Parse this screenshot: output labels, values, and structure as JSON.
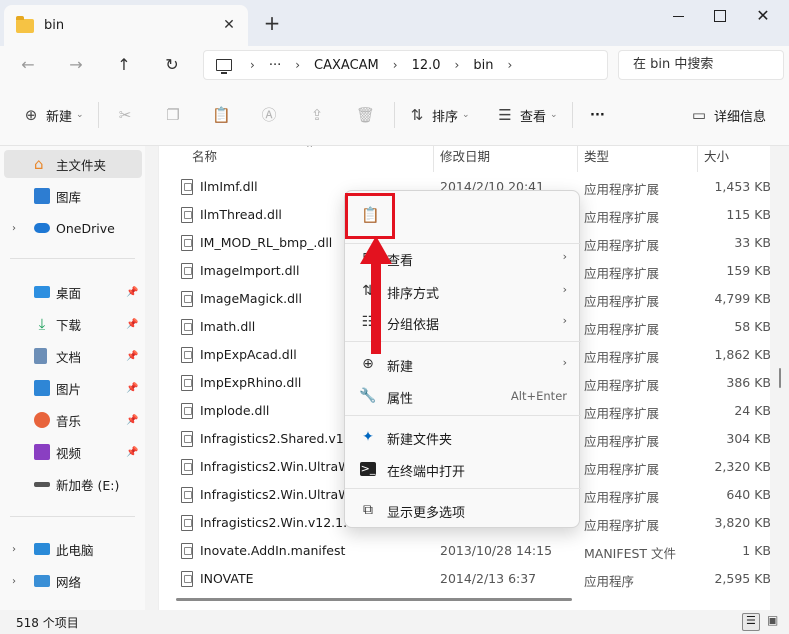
{
  "window": {
    "tab_title": "bin",
    "tab_close": "✕",
    "new_tab": "+",
    "minimize": "",
    "maximize": "",
    "close": "✕"
  },
  "nav": {
    "address_more": "···",
    "breadcrumbs": [
      "CAXACAM",
      "12.0",
      "bin"
    ],
    "search_placeholder": "在 bin 中搜索"
  },
  "commands": {
    "new": "新建",
    "sort": "排序",
    "view": "查看",
    "more": "···",
    "details": "详细信息"
  },
  "sidebar": {
    "home": "主文件夹",
    "gallery": "图库",
    "onedrive": "OneDrive",
    "desktop": "桌面",
    "downloads": "下载",
    "documents": "文档",
    "pictures": "图片",
    "music": "音乐",
    "videos": "视频",
    "new_volume": "新加卷 (E:)",
    "this_pc": "此电脑",
    "network": "网络"
  },
  "columns": {
    "name": "名称",
    "modified": "修改日期",
    "type": "类型",
    "size": "大小"
  },
  "files": [
    {
      "name": "IlmImf.dll",
      "date": "2014/2/10 20:41",
      "type": "应用程序扩展",
      "size": "1,453 KB"
    },
    {
      "name": "IlmThread.dll",
      "date": "",
      "type": "应用程序扩展",
      "size": "115 KB"
    },
    {
      "name": "IM_MOD_RL_bmp_.dll",
      "date": "",
      "type": "应用程序扩展",
      "size": "33 KB"
    },
    {
      "name": "ImageImport.dll",
      "date": "",
      "type": "应用程序扩展",
      "size": "159 KB"
    },
    {
      "name": "ImageMagick.dll",
      "date": "",
      "type": "应用程序扩展",
      "size": "4,799 KB"
    },
    {
      "name": "Imath.dll",
      "date": "",
      "type": "应用程序扩展",
      "size": "58 KB"
    },
    {
      "name": "ImpExpAcad.dll",
      "date": "",
      "type": "应用程序扩展",
      "size": "1,862 KB"
    },
    {
      "name": "ImpExpRhino.dll",
      "date": "",
      "type": "应用程序扩展",
      "size": "386 KB"
    },
    {
      "name": "Implode.dll",
      "date": "",
      "type": "应用程序扩展",
      "size": "24 KB"
    },
    {
      "name": "Infragistics2.Shared.v12.1",
      "date": "",
      "type": "应用程序扩展",
      "size": "304 KB"
    },
    {
      "name": "Infragistics2.Win.UltraWin",
      "date": "",
      "type": "应用程序扩展",
      "size": "2,320 KB"
    },
    {
      "name": "Infragistics2.Win.UltraWin",
      "date": "",
      "type": "应用程序扩展",
      "size": "640 KB"
    },
    {
      "name": "Infragistics2.Win.v12.1.dll",
      "date": "",
      "type": "应用程序扩展",
      "size": "3,820 KB"
    },
    {
      "name": "Inovate.AddIn.manifest",
      "date": "2013/10/28 14:15",
      "type": "MANIFEST 文件",
      "size": "1 KB"
    },
    {
      "name": "INOVATE",
      "date": "2014/2/13 6:37",
      "type": "应用程序",
      "size": "2,595 KB"
    }
  ],
  "context_menu": {
    "view": "查看",
    "sort_by": "排序方式",
    "group_by": "分组依据",
    "new": "新建",
    "properties": "属性",
    "properties_shortcut": "Alt+Enter",
    "new_folder": "新建文件夹",
    "open_terminal": "在终端中打开",
    "show_more": "显示更多选项"
  },
  "status": {
    "item_count": "518 个项目"
  },
  "colors": {
    "highlight_red": "#e3121f",
    "accent_blue": "#0067c0",
    "folder_yellow": "#f6c344"
  }
}
